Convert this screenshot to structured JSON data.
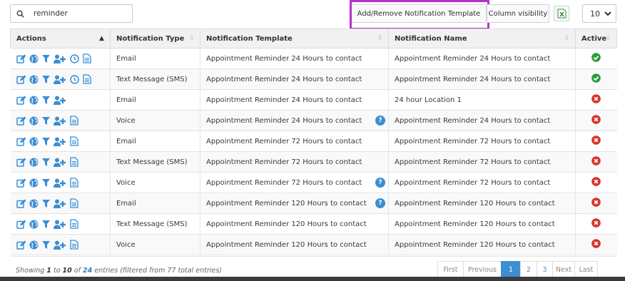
{
  "search": {
    "value": "reminder"
  },
  "toolbar": {
    "add_remove_label": "Add/Remove Notification Template",
    "column_visibility_label": "Column visibility",
    "page_size": "10"
  },
  "table": {
    "headers": {
      "actions": "Actions",
      "type": "Notification Type",
      "template": "Notification Template",
      "name": "Notification Name",
      "active": "Active"
    },
    "rows": [
      {
        "type": "Email",
        "template": "Appointment Reminder 24 Hours to contact",
        "name": "Appointment Reminder 24 Hours to contact",
        "active": true,
        "help": false,
        "clock": true,
        "adduser": true
      },
      {
        "type": "Text Message (SMS)",
        "template": "Appointment Reminder 24 Hours to contact",
        "name": "Appointment Reminder 24 Hours to contact",
        "active": true,
        "help": false,
        "clock": true,
        "adduser": true
      },
      {
        "type": "Email",
        "template": "Appointment Reminder 24 Hours to contact",
        "name": "24 hour Location 1",
        "active": false,
        "help": false,
        "clock": false,
        "adduser": true,
        "nodoc": true
      },
      {
        "type": "Voice",
        "template": "Appointment Reminder 24 Hours to contact",
        "name": "Appointment Reminder 24 Hours to contact",
        "active": false,
        "help": true,
        "clock": false,
        "adduser": true
      },
      {
        "type": "Email",
        "template": "Appointment Reminder 72 Hours to contact",
        "name": "Appointment Reminder 72 Hours to contact",
        "active": false,
        "help": false,
        "clock": false,
        "adduser": true
      },
      {
        "type": "Text Message (SMS)",
        "template": "Appointment Reminder 72 Hours to contact",
        "name": "Appointment Reminder 72 Hours to contact",
        "active": false,
        "help": false,
        "clock": false,
        "adduser": true
      },
      {
        "type": "Voice",
        "template": "Appointment Reminder 72 Hours to contact",
        "name": "Appointment Reminder 72 Hours to contact",
        "active": false,
        "help": true,
        "clock": false,
        "adduser": true
      },
      {
        "type": "Email",
        "template": "Appointment Reminder 120 Hours to contact",
        "name": "Appointment Reminder 120 Hours to contact",
        "active": false,
        "help": true,
        "clock": false,
        "adduser": true
      },
      {
        "type": "Text Message (SMS)",
        "template": "Appointment Reminder 120 Hours to contact",
        "name": "Appointment Reminder 120 Hours to contact",
        "active": false,
        "help": false,
        "clock": false,
        "adduser": true
      },
      {
        "type": "Voice",
        "template": "Appointment Reminder 120 Hours to contact",
        "name": "Appointment Reminder 120 Hours to contact",
        "active": false,
        "help": false,
        "clock": false,
        "adduser": true
      }
    ]
  },
  "footer": {
    "showing_prefix": "Showing ",
    "from": "1",
    "to_word": " to ",
    "to": "10",
    "of_word": " of ",
    "total": "24",
    "entries_word": " entries (filtered from ",
    "filtered_total": "77",
    "suffix": " total entries)"
  },
  "pagination": {
    "first": "First",
    "previous": "Previous",
    "pages": [
      "1",
      "2",
      "3"
    ],
    "current": "1",
    "next": "Next",
    "last": "Last"
  },
  "icons": {
    "edit": "edit-icon",
    "globe": "globe-icon",
    "filter": "filter-icon",
    "add_user": "add-user-icon",
    "clock": "clock-icon",
    "document": "document-icon",
    "help": "help-icon",
    "check": "check-circle-icon",
    "x": "x-circle-icon"
  },
  "colors": {
    "icon_blue": "#3a8ed4",
    "active_green": "#2e9b3a",
    "inactive_red": "#d8332b",
    "highlight_purple": "#b532c9",
    "page_active": "#3d8fd1"
  }
}
